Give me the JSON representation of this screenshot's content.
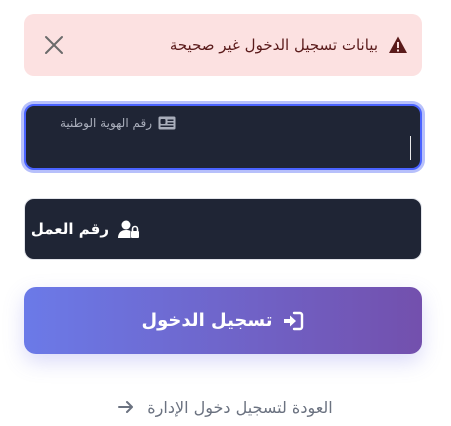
{
  "alert": {
    "message": "بيانات تسجيل الدخول غير صحيحة",
    "icon": "warning-triangle-icon",
    "close_icon": "close-icon",
    "bg_color": "#fce1e1",
    "text_color": "#5a1a1a"
  },
  "fields": {
    "national_id": {
      "label": "رقم الهوية الوطنية",
      "value": "",
      "icon": "id-card-icon",
      "focused": true
    },
    "work_number": {
      "label": "رقم العمل",
      "value": "",
      "icon": "user-lock-icon"
    }
  },
  "login_button": {
    "label": "تسجيل الدخول",
    "icon": "sign-in-icon",
    "gradient": [
      "#6b7ae8",
      "#7350ad"
    ]
  },
  "back_link": {
    "label": "العودة لتسجيل دخول الإدارة",
    "icon": "arrow-right-icon"
  },
  "colors": {
    "field_bg": "#1f2535",
    "focus_ring": "#4a63ff"
  }
}
